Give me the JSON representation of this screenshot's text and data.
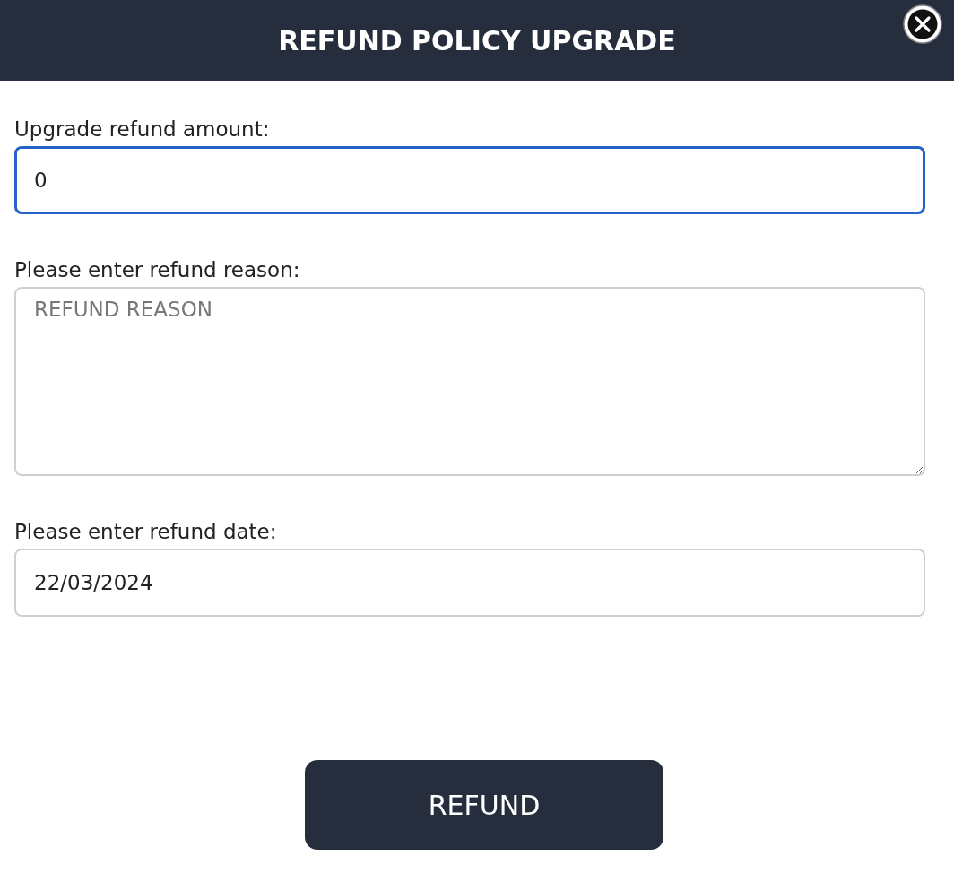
{
  "dialog": {
    "title": "REFUND POLICY UPGRADE"
  },
  "fields": [
    {
      "kind": "text",
      "label": "Upgrade refund amount:",
      "value": "0",
      "focused": true
    },
    {
      "kind": "textarea",
      "label": "Please enter refund reason:",
      "placeholder": "REFUND REASON",
      "focused": false
    },
    {
      "kind": "text",
      "label": "Please enter refund date:",
      "value": "22/03/2024",
      "focused": false
    }
  ],
  "submit_button": "REFUND"
}
